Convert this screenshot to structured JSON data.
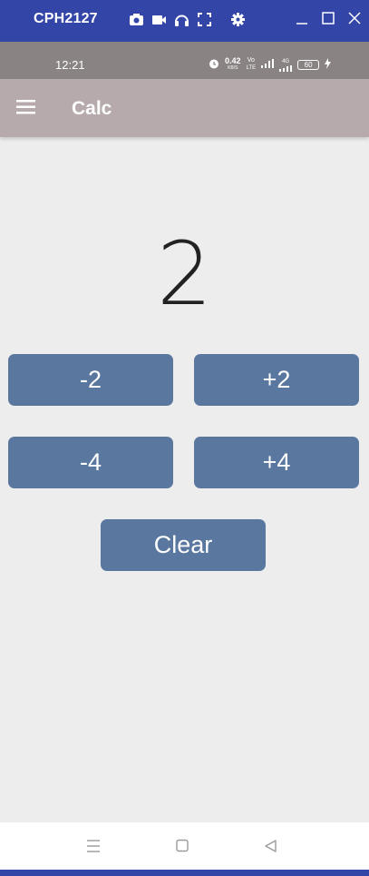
{
  "window": {
    "title": "CPH2127",
    "tools": [
      "camera-icon",
      "video-icon",
      "headphones-icon",
      "fullscreen-icon",
      "gear-icon"
    ],
    "controls": [
      "minimize-icon",
      "maximize-icon",
      "close-icon"
    ]
  },
  "status": {
    "time": "12:21",
    "speed": "0.42",
    "speed_unit": "KB/S",
    "net_top": "Vo",
    "net_bottom": "LTE",
    "gen": "4G",
    "battery": "60"
  },
  "app": {
    "title": "Calc"
  },
  "counter": {
    "value": "2"
  },
  "buttons": {
    "minus2": "-2",
    "plus2": "+2",
    "minus4": "-4",
    "plus4": "+4",
    "clear": "Clear"
  },
  "colors": {
    "window_bar": "#3445a8",
    "status_bar": "#898384",
    "app_bar": "#b7aaad",
    "button": "#5a77a0",
    "background": "#ededed"
  }
}
